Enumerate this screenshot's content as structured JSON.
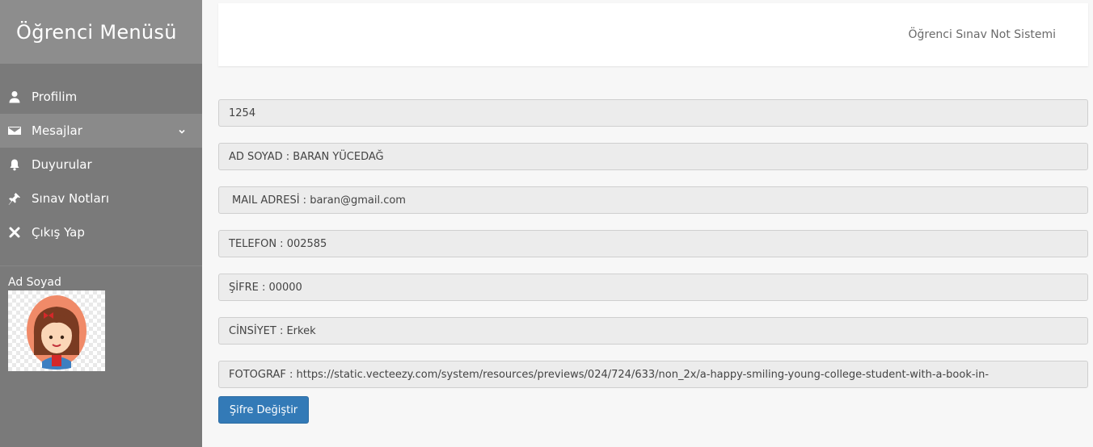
{
  "sidebar": {
    "title": "Öğrenci Menüsü",
    "items": [
      {
        "label": "Profilim",
        "icon": "user-icon"
      },
      {
        "label": "Mesajlar",
        "icon": "envelope-icon"
      },
      {
        "label": "Duyurular",
        "icon": "bell-icon"
      },
      {
        "label": "Sınav Notları",
        "icon": "pushpin-icon"
      },
      {
        "label": "Çıkış Yap",
        "icon": "close-icon"
      }
    ],
    "profile_label": "Ad Soyad"
  },
  "header": {
    "title": "Öğrenci Sınav Not Sistemi"
  },
  "form": {
    "fields": [
      {
        "value": "1254"
      },
      {
        "value": "AD SOYAD : BARAN YÜCEDAĞ"
      },
      {
        "value": "MAIL ADRESİ : baran@gmail.com"
      },
      {
        "value": "TELEFON : 002585"
      },
      {
        "value": "ŞİFRE : 00000"
      },
      {
        "value": "CİNSİYET : Erkek"
      },
      {
        "value": "FOTOGRAF : https://static.vecteezy.com/system/resources/previews/024/724/633/non_2x/a-happy-smiling-young-college-student-with-a-book-in-"
      }
    ],
    "button_label": "Şifre Değiştir"
  },
  "colors": {
    "sidebar_bg": "#7a7a7a",
    "sidebar_header_bg": "#8d8d8d",
    "active_item_bg": "#8a8a8a",
    "button_bg": "#337ab7",
    "field_bg": "#ececec"
  }
}
